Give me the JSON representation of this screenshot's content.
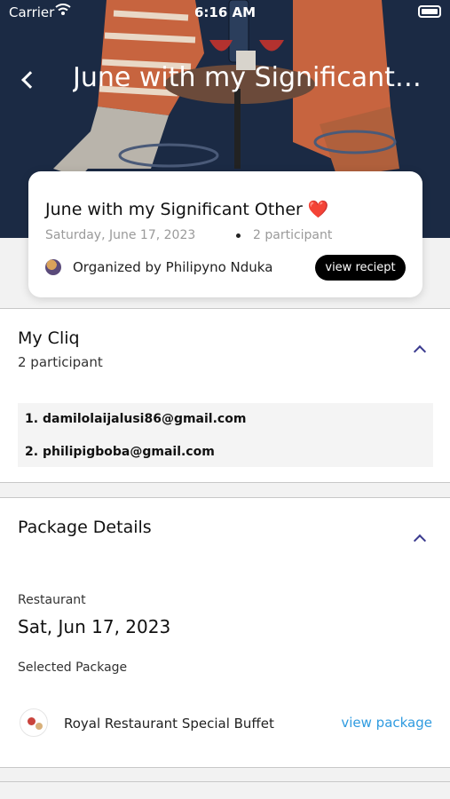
{
  "status_bar": {
    "carrier": "Carrier",
    "time": "6:16 AM"
  },
  "header": {
    "title": "June with my Significant Other",
    "back_icon": "chevron-left-icon"
  },
  "event_card": {
    "title": "June with my Significant Other ❤️",
    "date": "Saturday, June 17, 2023",
    "participants": "2 participant",
    "organizer": "Organized by Philipyno Nduka",
    "receipt_button": "view reciept"
  },
  "cliq": {
    "title": "My Cliq",
    "subtitle": "2 participant",
    "members": [
      {
        "num": "1.",
        "email": "damilolaijalusi86@gmail.com"
      },
      {
        "num": "2.",
        "email": "philipigboba@gmail.com"
      }
    ]
  },
  "package": {
    "title": "Package Details",
    "restaurant_label": "Restaurant",
    "date": "Sat, Jun 17, 2023",
    "selected_label": "Selected Package",
    "package_name": "Royal Restaurant Special Buffet",
    "view_link": "view package"
  },
  "colors": {
    "hero_bg": "#1b2a44",
    "accent": "#3b3b8f",
    "link": "#2f9be0"
  }
}
